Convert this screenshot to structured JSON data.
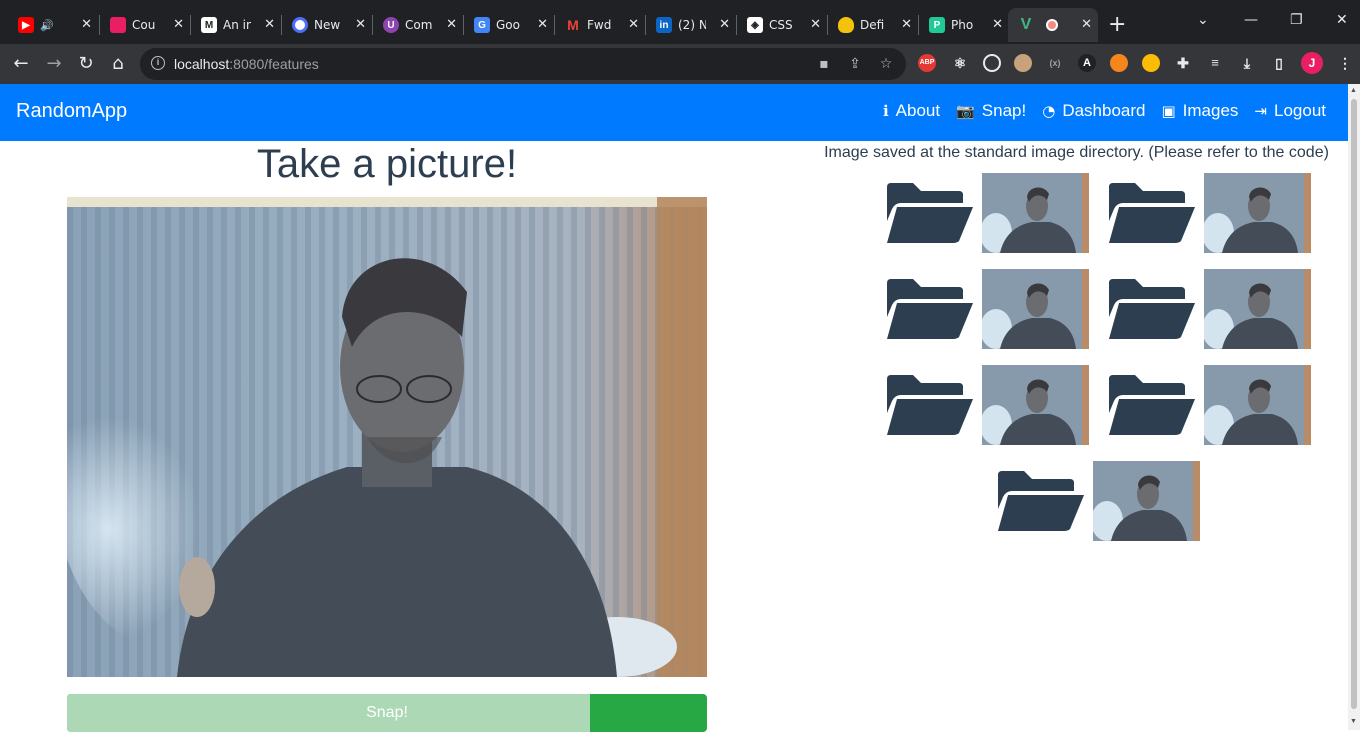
{
  "browser": {
    "tabs": [
      {
        "title": "",
        "favicon": "youtube-icon",
        "color": "#ff0000"
      },
      {
        "title": "Cou",
        "favicon": "app-icon",
        "color": "#e91e63"
      },
      {
        "title": "An in",
        "favicon": "medium-icon",
        "color": "#ffffff"
      },
      {
        "title": "New",
        "favicon": "app-icon",
        "color": "#4f6ef7"
      },
      {
        "title": "Com",
        "favicon": "app-icon",
        "color": "#8e44ad"
      },
      {
        "title": "Goo",
        "favicon": "google-translate-icon",
        "color": "#4285f4"
      },
      {
        "title": "Fwd",
        "favicon": "gmail-icon",
        "color": "#ea4335"
      },
      {
        "title": "(2) N",
        "favicon": "linkedin-icon",
        "color": "#0a66c2"
      },
      {
        "title": "CSS",
        "favicon": "codepen-icon",
        "color": "#ffffff"
      },
      {
        "title": "Defi",
        "favicon": "pineapple-icon",
        "color": "#f4c20d"
      },
      {
        "title": "Pho",
        "favicon": "app-icon",
        "color": "#20c997"
      },
      {
        "title": "",
        "favicon": "vue-icon",
        "color": "#41b883"
      }
    ],
    "url_host": "localhost",
    "url_path": ":8080/features",
    "profile_initial": "J",
    "extensions": [
      "ABP"
    ]
  },
  "app": {
    "brand": "RandomApp",
    "nav": [
      {
        "label": "About",
        "icon": "info-icon"
      },
      {
        "label": "Snap!",
        "icon": "camera-icon"
      },
      {
        "label": "Dashboard",
        "icon": "dashboard-icon"
      },
      {
        "label": "Images",
        "icon": "images-icon"
      },
      {
        "label": "Logout",
        "icon": "logout-icon"
      }
    ],
    "accent": "#007bff"
  },
  "main": {
    "title": "Take a picture!",
    "snap_label": "Snap!",
    "saved_note": "Image saved at the standard image directory. (Please refer to the code)",
    "gallery_count": 7
  }
}
